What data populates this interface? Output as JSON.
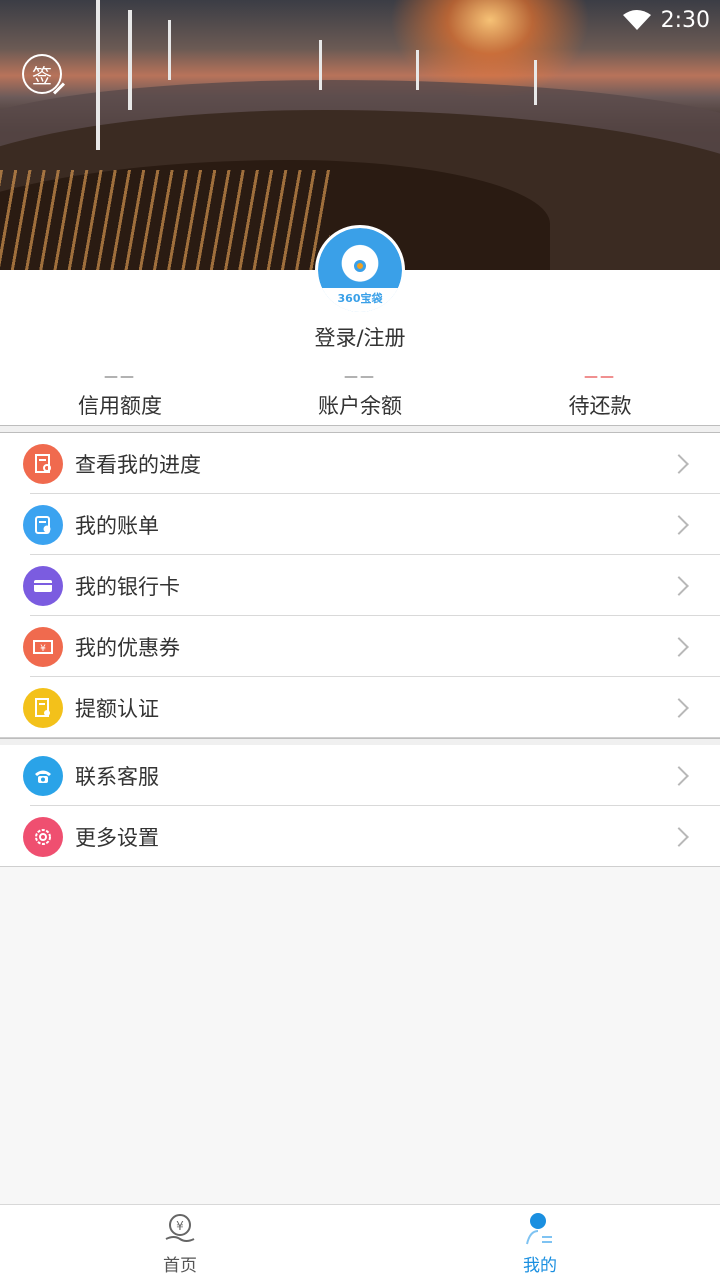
{
  "status_bar": {
    "time": "2:30"
  },
  "header": {
    "sign_label": "签"
  },
  "profile": {
    "avatar_logo": "360宝袋",
    "login_label": "登录/注册"
  },
  "stats": [
    {
      "value": "——",
      "label": "信用额度"
    },
    {
      "value": "——",
      "label": "账户余额"
    },
    {
      "value": "——",
      "label": "待还款"
    }
  ],
  "menu_group_1": [
    {
      "label": "查看我的进度",
      "icon": "progress-icon",
      "color": "#f06a4e"
    },
    {
      "label": "我的账单",
      "icon": "bill-icon",
      "color": "#3ba3f0"
    },
    {
      "label": "我的银行卡",
      "icon": "bank-card-icon",
      "color": "#7b5ce0"
    },
    {
      "label": "我的优惠券",
      "icon": "coupon-icon",
      "color": "#f06a4e"
    },
    {
      "label": "提额认证",
      "icon": "certify-icon",
      "color": "#f3c11a"
    }
  ],
  "menu_group_2": [
    {
      "label": "联系客服",
      "icon": "phone-icon",
      "color": "#2aa3e8"
    },
    {
      "label": "更多设置",
      "icon": "settings-icon",
      "color": "#ef4f70"
    }
  ],
  "bottom_nav": [
    {
      "label": "首页",
      "icon": "home-yuan-icon",
      "active": false
    },
    {
      "label": "我的",
      "icon": "user-icon",
      "active": true
    }
  ],
  "colors": {
    "accent": "#1a8fe0",
    "pending_red": "#e02020"
  }
}
